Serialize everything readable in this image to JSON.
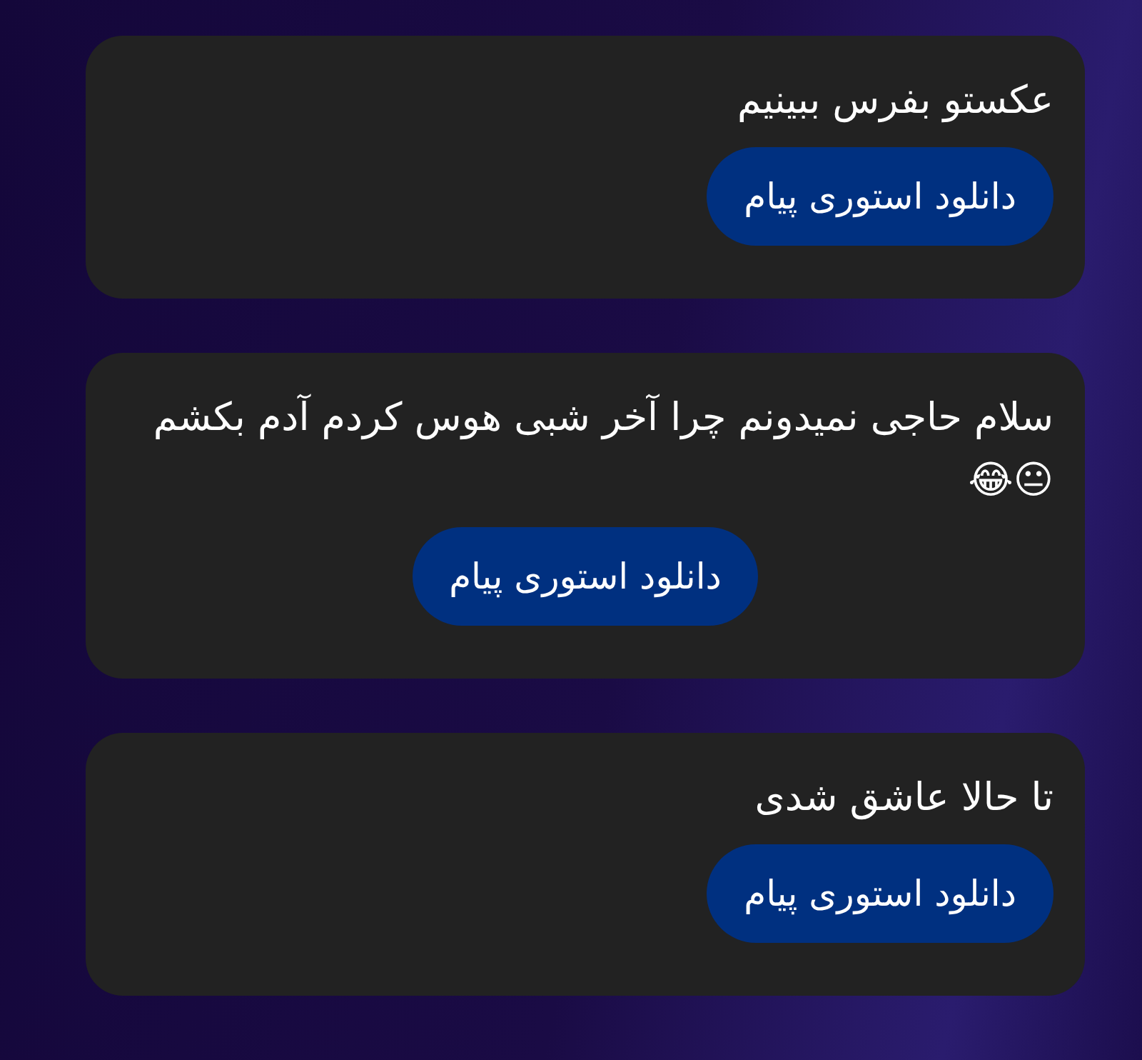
{
  "messages": [
    {
      "text": "عکستو بفرس ببینیم",
      "button": "دانلود استوری پیام",
      "button_centered": false
    },
    {
      "text": "سلام حاجی نمیدونم چرا آخر شبی هوس کردم آدم بکشم😐😂",
      "button": "دانلود استوری پیام",
      "button_centered": true
    },
    {
      "text": "تا حالا عاشق شدی",
      "button": "دانلود استوری پیام",
      "button_centered": false
    }
  ]
}
